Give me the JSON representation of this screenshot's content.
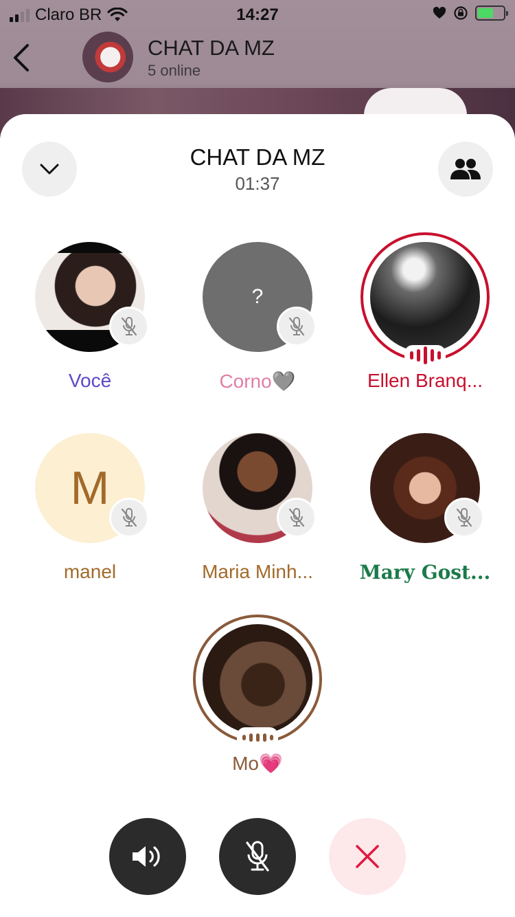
{
  "status_bar": {
    "carrier": "Claro BR",
    "time": "14:27"
  },
  "chat_header": {
    "title": "CHAT DA MZ",
    "subtitle": "5 online"
  },
  "call": {
    "title": "CHAT DA MZ",
    "timer": "01:37"
  },
  "participants": [
    {
      "name": "Você",
      "color": "#5b49c9",
      "muted": true
    },
    {
      "name": "Corno🩶",
      "color": "#e07fa6",
      "muted": true,
      "avatar_text": "?"
    },
    {
      "name": "Ellen Branq...",
      "color": "#c8102e",
      "speaking": true
    },
    {
      "name": "manel",
      "color": "#a26a2a",
      "muted": true,
      "avatar_text": "M"
    },
    {
      "name": "Maria Minh...",
      "color": "#a26a2a",
      "muted": true
    },
    {
      "name": "Mary Gost...",
      "color": "#1b7a4a",
      "muted": true
    },
    {
      "name": "Mo💗",
      "color": "#8a5a3a",
      "speaking": true
    }
  ],
  "icons": {
    "back": "chevron-left-icon",
    "collapse": "chevron-down-icon",
    "members": "people-icon",
    "speaker": "speaker-icon",
    "mic": "mic-off-icon",
    "leave": "close-icon"
  }
}
